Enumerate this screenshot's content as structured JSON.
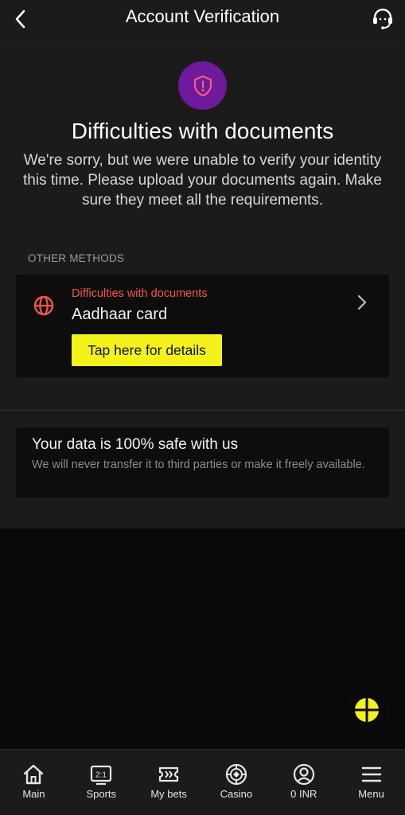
{
  "header": {
    "title": "Account Verification",
    "back_icon": "chevron-left-icon",
    "support_icon": "headset-icon"
  },
  "main": {
    "badge_icon": "shield-alert-icon",
    "heading": "Difficulties with documents",
    "description": "We're sorry, but we were unable to verify your identity this time. Please upload your documents again. Make sure they meet all the requirements.",
    "section_label": "OTHER METHODS",
    "method_card": {
      "icon": "globe-icon",
      "status": "Difficulties with documents",
      "name": "Aadhaar card",
      "button_label": "Tap here for details"
    },
    "safe_card": {
      "title": "Your data is 100% safe with us",
      "description": "We will never transfer it to third parties or make it freely available."
    }
  },
  "fab": {
    "icon": "chat-ball-icon"
  },
  "bottom_nav": {
    "items": [
      {
        "label": "Main",
        "icon": "home-icon"
      },
      {
        "label": "Sports",
        "icon": "scoreboard-icon"
      },
      {
        "label": "My bets",
        "icon": "ticket-icon"
      },
      {
        "label": "Casino",
        "icon": "casino-chip-icon"
      },
      {
        "label": "0 INR",
        "icon": "account-icon"
      },
      {
        "label": "Menu",
        "icon": "hamburger-menu-icon"
      }
    ]
  },
  "colors": {
    "accent_yellow": "#f3f21a",
    "error_red": "#f2564c",
    "badge_purple": "#6d1a9c",
    "panel": "#1b1b1b",
    "background": "#080808"
  }
}
